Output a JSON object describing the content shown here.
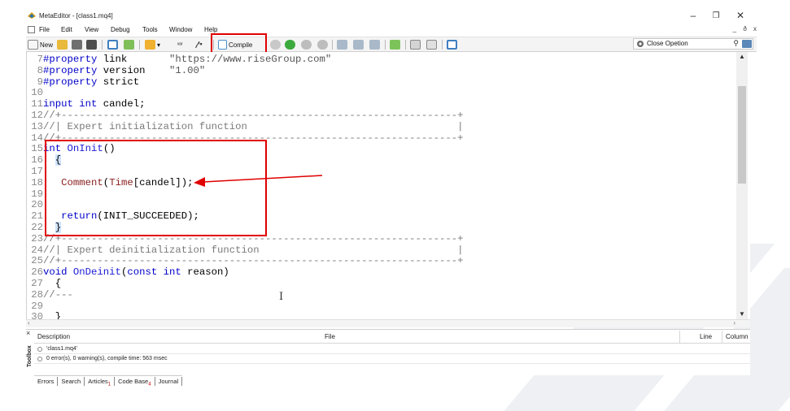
{
  "window": {
    "title": "MetaEditor - [class1.mq4]"
  },
  "menu": [
    "File",
    "Edit",
    "View",
    "Debug",
    "Tools",
    "Window",
    "Help"
  ],
  "toolbar": {
    "new_label": "New",
    "compile_label": "Compile",
    "search_value": "Close Opetion"
  },
  "colors": {
    "highlight": "#e00000",
    "keyword": "#0000c8"
  },
  "code": {
    "lines": [
      {
        "n": "7",
        "segs": [
          {
            "c": "kw",
            "t": "#property "
          },
          {
            "c": "",
            "t": "link       "
          },
          {
            "c": "str",
            "t": "\"https://www.riseGroup.com\""
          }
        ]
      },
      {
        "n": "8",
        "segs": [
          {
            "c": "kw",
            "t": "#property "
          },
          {
            "c": "",
            "t": "version    "
          },
          {
            "c": "str",
            "t": "\"1.00\""
          }
        ]
      },
      {
        "n": "9",
        "segs": [
          {
            "c": "kw",
            "t": "#property "
          },
          {
            "c": "",
            "t": "strict"
          }
        ]
      },
      {
        "n": "10",
        "segs": []
      },
      {
        "n": "11",
        "segs": [
          {
            "c": "kw",
            "t": "input int "
          },
          {
            "c": "",
            "t": "candel;"
          }
        ]
      },
      {
        "n": "12",
        "segs": [
          {
            "c": "cmt",
            "t": "//+------------------------------------------------------------------+"
          }
        ]
      },
      {
        "n": "13",
        "segs": [
          {
            "c": "cmt",
            "t": "//| Expert initialization function                                   |"
          }
        ]
      },
      {
        "n": "14",
        "segs": [
          {
            "c": "cmt",
            "t": "//+------------------------------------------------------------------+"
          }
        ]
      },
      {
        "n": "15",
        "segs": [
          {
            "c": "kw",
            "t": "int "
          },
          {
            "c": "fn",
            "t": "OnInit"
          },
          {
            "c": "",
            "t": "()"
          }
        ]
      },
      {
        "n": "16",
        "segs": [
          {
            "c": "",
            "t": "  "
          },
          {
            "c": "brace",
            "t": "{"
          }
        ]
      },
      {
        "n": "17",
        "segs": []
      },
      {
        "n": "18",
        "segs": [
          {
            "c": "",
            "t": "   "
          },
          {
            "c": "call",
            "t": "Comment"
          },
          {
            "c": "",
            "t": "("
          },
          {
            "c": "call",
            "t": "Time"
          },
          {
            "c": "",
            "t": "[candel]);"
          }
        ]
      },
      {
        "n": "19",
        "segs": []
      },
      {
        "n": "20",
        "segs": []
      },
      {
        "n": "21",
        "segs": [
          {
            "c": "",
            "t": "   "
          },
          {
            "c": "kw",
            "t": "return"
          },
          {
            "c": "",
            "t": "(INIT_SUCCEEDED);"
          }
        ]
      },
      {
        "n": "22",
        "segs": [
          {
            "c": "",
            "t": "  "
          },
          {
            "c": "brace",
            "t": "}"
          }
        ]
      },
      {
        "n": "23",
        "segs": [
          {
            "c": "cmt",
            "t": "//+------------------------------------------------------------------+"
          }
        ]
      },
      {
        "n": "24",
        "segs": [
          {
            "c": "cmt",
            "t": "//| Expert deinitialization function                                 |"
          }
        ]
      },
      {
        "n": "25",
        "segs": [
          {
            "c": "cmt",
            "t": "//+------------------------------------------------------------------+"
          }
        ]
      },
      {
        "n": "26",
        "segs": [
          {
            "c": "kw",
            "t": "void "
          },
          {
            "c": "fn",
            "t": "OnDeinit"
          },
          {
            "c": "",
            "t": "("
          },
          {
            "c": "kw",
            "t": "const int "
          },
          {
            "c": "",
            "t": "reason)"
          }
        ]
      },
      {
        "n": "27",
        "segs": [
          {
            "c": "",
            "t": "  {"
          }
        ]
      },
      {
        "n": "28",
        "segs": [
          {
            "c": "cmt",
            "t": "//---"
          }
        ]
      },
      {
        "n": "29",
        "segs": []
      },
      {
        "n": "30",
        "segs": [
          {
            "c": "",
            "t": "  }"
          }
        ]
      }
    ]
  },
  "toolbox": {
    "label": "Toolbox",
    "columns": {
      "description": "Description",
      "file": "File",
      "line": "Line",
      "column": "Column"
    },
    "rows": [
      "'class1.mq4'",
      "0 error(s), 0 warning(s), compile time: 563 msec"
    ],
    "tabs": [
      {
        "label": "Errors",
        "badge": ""
      },
      {
        "label": "Search",
        "badge": ""
      },
      {
        "label": "Articles",
        "badge": "1"
      },
      {
        "label": "Code Base",
        "badge": "4"
      },
      {
        "label": "Journal",
        "badge": ""
      }
    ]
  }
}
